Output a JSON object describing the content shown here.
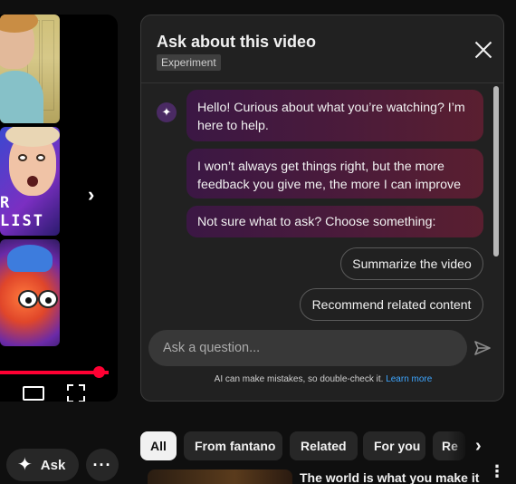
{
  "panel": {
    "title": "Ask about this video",
    "badge": "Experiment",
    "messages": [
      "Hello! Curious about what you’re watching? I’m here to help.",
      "I won’t always get things right, but the more feedback you give me, the more I can improve",
      "Not sure what to ask? Choose something:"
    ],
    "suggestions": [
      "Summarize the video",
      "Recommend related content"
    ],
    "input_placeholder": "Ask a question...",
    "disclaimer": "AI can make mistakes, so double-check it.",
    "learn_more": "Learn more"
  },
  "player": {
    "thumb_caption": "R LIST",
    "progress": 0.94
  },
  "actions": {
    "ask_label": "Ask",
    "more_label": "···"
  },
  "filters": {
    "chips": [
      "All",
      "From fantano",
      "Related",
      "For you",
      "Re"
    ],
    "active": "All"
  },
  "next_video": {
    "title": "The world is what you make it"
  },
  "colors": {
    "background": "#0f0f0f",
    "panel": "#212121",
    "bubble_start": "#3b1744",
    "bubble_end": "#5a1f30",
    "progress": "#ff0033",
    "link": "#3ea6ff"
  }
}
